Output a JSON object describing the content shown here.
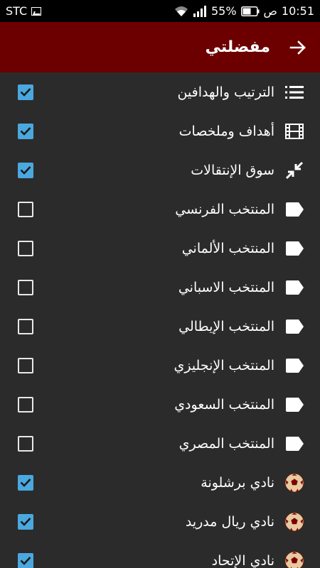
{
  "status_bar": {
    "carrier": "STC",
    "battery_percent": "55%",
    "am_pm": "ص",
    "time": "10:51"
  },
  "app_bar": {
    "title": "مفضلتي"
  },
  "items": [
    {
      "label": "الترتيب والهدافين",
      "checked": true,
      "icon": "list-icon"
    },
    {
      "label": "أهداف وملخصات",
      "checked": true,
      "icon": "film-icon"
    },
    {
      "label": "سوق الإنتقالات",
      "checked": true,
      "icon": "transfer-arrows-icon"
    },
    {
      "label": "المنتخب الفرنسي",
      "checked": false,
      "icon": "tag-icon"
    },
    {
      "label": "المنتخب الألماني",
      "checked": false,
      "icon": "tag-icon"
    },
    {
      "label": "المنتخب الاسباني",
      "checked": false,
      "icon": "tag-icon"
    },
    {
      "label": "المنتخب الإيطالي",
      "checked": false,
      "icon": "tag-icon"
    },
    {
      "label": "المنتخب الإنجليزي",
      "checked": false,
      "icon": "tag-icon"
    },
    {
      "label": "المنتخب السعودي",
      "checked": false,
      "icon": "tag-icon"
    },
    {
      "label": "المنتخب المصري",
      "checked": false,
      "icon": "tag-icon"
    },
    {
      "label": "نادي برشلونة",
      "checked": true,
      "icon": "football-icon"
    },
    {
      "label": "نادي ريال مدريد",
      "checked": true,
      "icon": "football-icon"
    },
    {
      "label": "نادي الإتحاد",
      "checked": true,
      "icon": "football-icon"
    }
  ],
  "colors": {
    "app_bar": "#6c0000",
    "background": "#2b2b2b",
    "checkbox_checked": "#4aa8df"
  }
}
